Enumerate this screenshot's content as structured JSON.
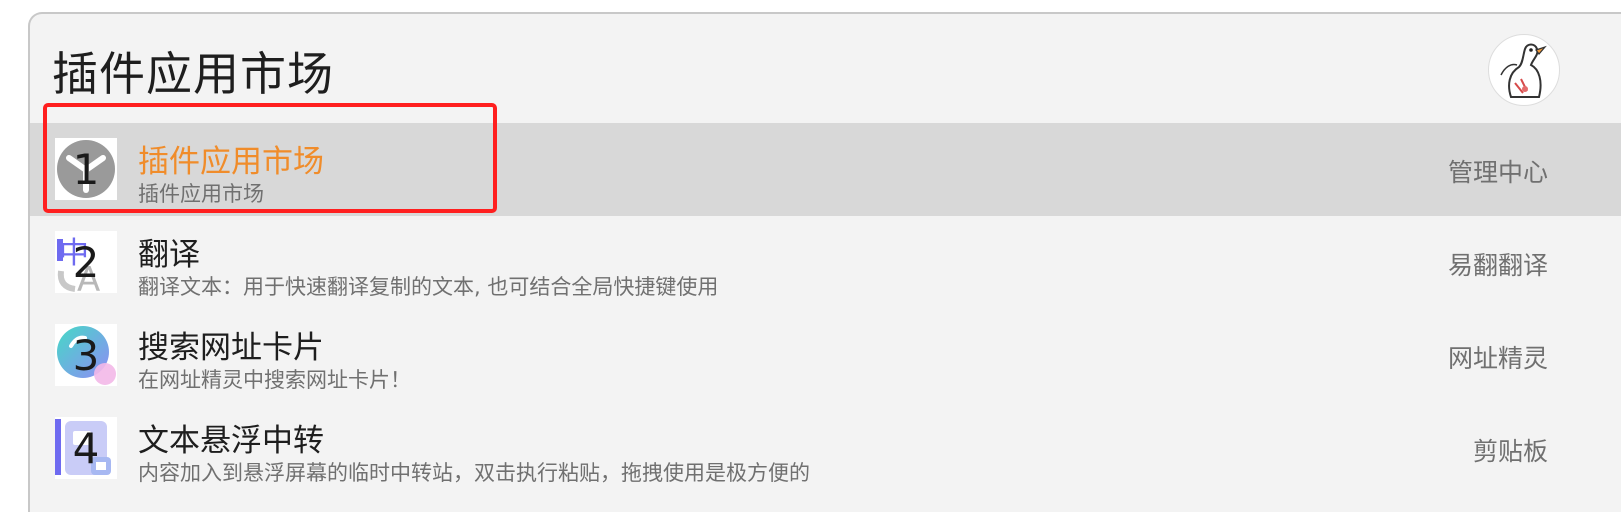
{
  "search": {
    "query": "插件应用市场"
  },
  "results": [
    {
      "index": "1",
      "title": "插件应用市场",
      "description": "插件应用市场",
      "source": "管理中心",
      "icon": "plugin-market-icon",
      "selected": true
    },
    {
      "index": "2",
      "title": "翻译",
      "description": "翻译文本：用于快速翻译复制的文本, 也可结合全局快捷键使用",
      "source": "易翻翻译",
      "icon": "translate-icon",
      "selected": false
    },
    {
      "index": "3",
      "title": "搜索网址卡片",
      "description": "在网址精灵中搜索网址卡片！",
      "source": "网址精灵",
      "icon": "url-search-icon",
      "selected": false
    },
    {
      "index": "4",
      "title": "文本悬浮中转",
      "description": "内容加入到悬浮屏幕的临时中转站，双击执行粘贴，拖拽使用是极方便的",
      "source": "剪贴板",
      "icon": "clipboard-float-icon",
      "selected": false
    }
  ],
  "colors": {
    "accent": "#f08c2a",
    "selected_row": "#d8d8d8",
    "highlight_border": "#ff1f1f",
    "background": "#f3f3f3"
  }
}
